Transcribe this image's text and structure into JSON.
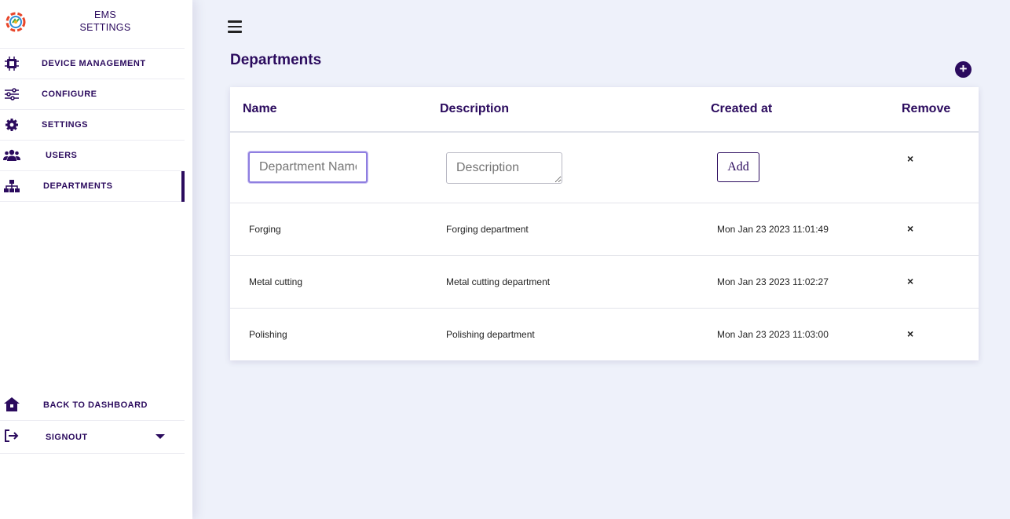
{
  "sidebar": {
    "brand_line1": "EMS",
    "brand_line2": "SETTINGS",
    "items": [
      {
        "label": "DEVICE MANAGEMENT",
        "icon": "chip-icon"
      },
      {
        "label": "CONFIGURE",
        "icon": "sliders-icon"
      },
      {
        "label": "SETTINGS",
        "icon": "gear-icon"
      },
      {
        "label": "USERS",
        "icon": "users-icon"
      },
      {
        "label": "DEPARTMENTS",
        "icon": "sitemap-icon",
        "active": true
      }
    ],
    "bottom": [
      {
        "label": "BACK TO DASHBOARD",
        "icon": "home-icon"
      },
      {
        "label": "SIGNOUT",
        "icon": "signout-icon"
      }
    ]
  },
  "main": {
    "title": "Departments",
    "add_symbol": "+"
  },
  "table": {
    "headers": {
      "name": "Name",
      "description": "Description",
      "created": "Created at",
      "remove": "Remove"
    },
    "form": {
      "name_placeholder": "Department Name",
      "description_placeholder": "Description",
      "add_label": "Add",
      "remove_symbol": "×"
    },
    "rows": [
      {
        "name": "Forging",
        "description": "Forging department",
        "created": "Mon Jan 23 2023 11:01:49",
        "remove": "×"
      },
      {
        "name": "Metal cutting",
        "description": "Metal cutting department",
        "created": "Mon Jan 23 2023 11:02:27",
        "remove": "×"
      },
      {
        "name": "Polishing",
        "description": "Polishing department",
        "created": "Mon Jan 23 2023 11:03:00",
        "remove": "×"
      }
    ]
  },
  "colors": {
    "accent": "#2b0b5e",
    "background": "#eef1fa"
  }
}
